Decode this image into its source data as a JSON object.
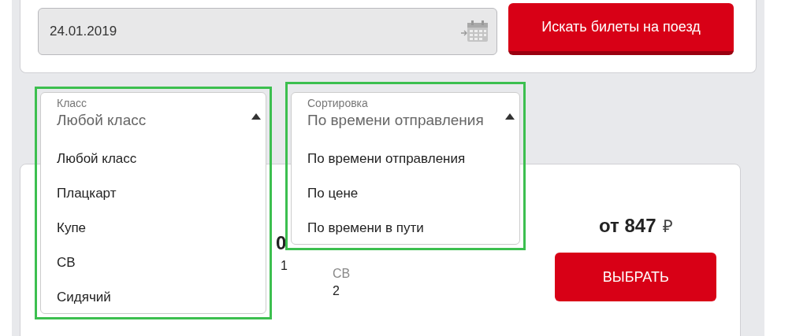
{
  "search": {
    "date": "24.01.2019",
    "button": "Искать билеты на поезд"
  },
  "filters": [
    {
      "label": "Класс",
      "value": "Любой класс",
      "expanded": true,
      "options": [
        "Любой класс",
        "Плацкарт",
        "Купе",
        "СВ",
        "Сидячий"
      ]
    },
    {
      "label": "Сортировка",
      "value": "По времени отправления",
      "expanded": true,
      "options": [
        "По времени отправления",
        "По цене",
        "По времени в пути"
      ]
    }
  ],
  "train": {
    "cut_time": "0",
    "cut_count": "1",
    "seat_types": [
      {
        "label": "СВ",
        "count": "2"
      }
    ],
    "price": "от 847",
    "currency": "₽",
    "button": "ВЫБРАТЬ"
  }
}
